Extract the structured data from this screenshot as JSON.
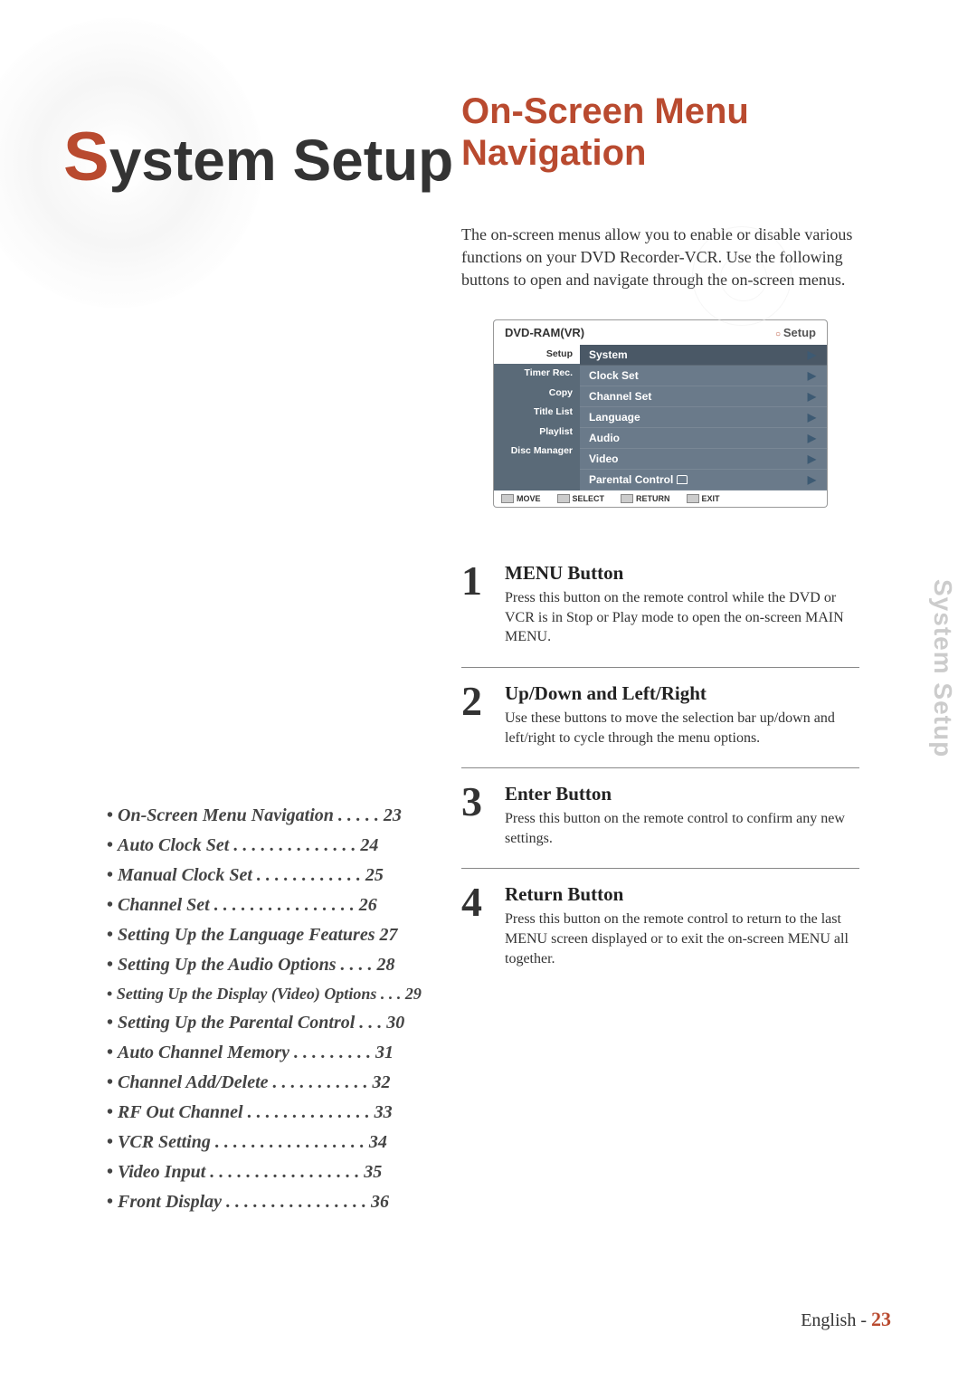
{
  "main_title": {
    "first": "S",
    "rest": "ystem Setup"
  },
  "sidebar_label": "System Setup",
  "toc": [
    {
      "title": "On-Screen Menu Navigation",
      "dots": " . . . . . ",
      "page": "23"
    },
    {
      "title": "Auto Clock Set",
      "dots": "  . . . . . . . . . . . . . . ",
      "page": "24"
    },
    {
      "title": "Manual Clock Set",
      "dots": "  . . . . . . . . . . . . ",
      "page": "25"
    },
    {
      "title": "Channel Set",
      "dots": "  . . . . . . . . . . . . . . . . ",
      "page": "26"
    },
    {
      "title": "Setting Up the Language Features",
      "dots": "   ",
      "page": "27"
    },
    {
      "title": "Setting Up the Audio Options",
      "dots": "  . . . . ",
      "page": "28"
    },
    {
      "title": "Setting Up the Display (Video) Options",
      "dots": " . . . ",
      "page": "29"
    },
    {
      "title": "Setting Up the Parental Control",
      "dots": " . . . ",
      "page": "30"
    },
    {
      "title": "Auto Channel Memory",
      "dots": "  . . . . . . . . . ",
      "page": "31"
    },
    {
      "title": "Channel Add/Delete",
      "dots": "  . . . . . . . . . . . ",
      "page": "32"
    },
    {
      "title": "RF Out Channel",
      "dots": "  . . . . . . . . . . . . . . ",
      "page": "33"
    },
    {
      "title": "VCR Setting",
      "dots": "  . . . . . . . . . . . . . . . . . ",
      "page": "34"
    },
    {
      "title": "Video Input",
      "dots": "  . . . . . . . . . . . . . . . . . ",
      "page": "35"
    },
    {
      "title": "Front Display",
      "dots": "  . . . . . . . . . . . . . . . . ",
      "page": "36"
    }
  ],
  "section_title": "On-Screen Menu Navigation",
  "intro": "The on-screen menus allow you to enable or disable  various functions on your DVD Recorder-VCR. Use the following buttons to open and navigate through the on-screen menus.",
  "menu": {
    "header_left": "DVD-RAM(VR)",
    "header_right": "Setup",
    "side": [
      "Setup",
      "Timer Rec.",
      "Copy",
      "Title List",
      "Playlist",
      "Disc Manager"
    ],
    "main": [
      "System",
      "Clock Set",
      "Channel Set",
      "Language",
      "Audio",
      "Video",
      "Parental Control"
    ],
    "footer": [
      "MOVE",
      "SELECT",
      "RETURN",
      "EXIT"
    ]
  },
  "steps": [
    {
      "num": "1",
      "title": "MENU Button",
      "desc": "Press this button on the remote control while the DVD or VCR is in Stop or Play mode to open the on-screen MAIN MENU."
    },
    {
      "num": "2",
      "title": "Up/Down and Left/Right",
      "desc": "Use these buttons to move the selection bar up/down and left/right to cycle through the menu options."
    },
    {
      "num": "3",
      "title": "Enter  Button",
      "desc": "Press this button on the remote control to confirm any new settings."
    },
    {
      "num": "4",
      "title": "Return  Button",
      "desc": "Press this button on the remote control to return to the last MENU screen displayed or to exit the on-screen MENU all together."
    }
  ],
  "footer": {
    "lang": "English - ",
    "page": "23"
  }
}
